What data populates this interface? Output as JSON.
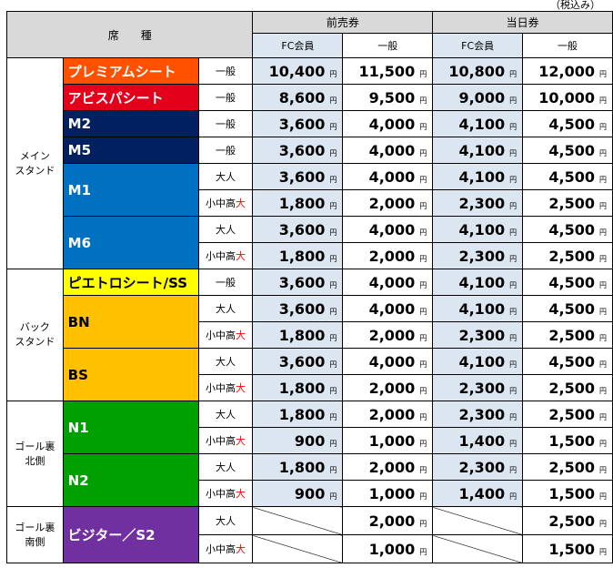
{
  "note": "（税込み）",
  "header": {
    "seat_type": "席　　種",
    "advance": "前売券",
    "same_day": "当日券",
    "fc_member": "FC会員",
    "general": "一般"
  },
  "yen_mark": "円",
  "sections": [
    {
      "area": "メイン\nスタンド",
      "seats": [
        {
          "name": "プレミアムシート",
          "bg": "#ff5000",
          "fg": "#ffffff",
          "rows": [
            {
              "sub": "一般",
              "subRed": "",
              "prices": [
                "10,400",
                "11,500",
                "10,800",
                "12,000"
              ]
            }
          ]
        },
        {
          "name": "アビスパシート",
          "bg": "#e2001a",
          "fg": "#ffffff",
          "rows": [
            {
              "sub": "一般",
              "subRed": "",
              "prices": [
                "8,600",
                "9,500",
                "9,000",
                "10,000"
              ]
            }
          ]
        },
        {
          "name": "M2",
          "bg": "#002060",
          "fg": "#ffffff",
          "rows": [
            {
              "sub": "一般",
              "subRed": "",
              "prices": [
                "3,600",
                "4,000",
                "4,100",
                "4,500"
              ]
            }
          ]
        },
        {
          "name": "M5",
          "bg": "#002060",
          "fg": "#ffffff",
          "rows": [
            {
              "sub": "一般",
              "subRed": "",
              "prices": [
                "3,600",
                "4,000",
                "4,100",
                "4,500"
              ]
            }
          ]
        },
        {
          "name": "M1",
          "bg": "#0070c0",
          "fg": "#ffffff",
          "rows": [
            {
              "sub": "大人",
              "subRed": "",
              "prices": [
                "3,600",
                "4,000",
                "4,100",
                "4,500"
              ]
            },
            {
              "sub": "小中高",
              "subRed": "大",
              "prices": [
                "1,800",
                "2,000",
                "2,300",
                "2,500"
              ]
            }
          ]
        },
        {
          "name": "M6",
          "bg": "#0070c0",
          "fg": "#ffffff",
          "rows": [
            {
              "sub": "大人",
              "subRed": "",
              "prices": [
                "3,600",
                "4,000",
                "4,100",
                "4,500"
              ]
            },
            {
              "sub": "小中高",
              "subRed": "大",
              "prices": [
                "1,800",
                "2,000",
                "2,300",
                "2,500"
              ]
            }
          ]
        }
      ]
    },
    {
      "area": "バック\nスタンド",
      "seats": [
        {
          "name": "ピエトロシート/SS",
          "bg": "#ffff00",
          "fg": "#000000",
          "rows": [
            {
              "sub": "一般",
              "subRed": "",
              "prices": [
                "3,600",
                "4,000",
                "4,100",
                "4,500"
              ]
            }
          ]
        },
        {
          "name": "BN",
          "bg": "#ffc000",
          "fg": "#000000",
          "rows": [
            {
              "sub": "大人",
              "subRed": "",
              "prices": [
                "3,600",
                "4,000",
                "4,100",
                "4,500"
              ]
            },
            {
              "sub": "小中高",
              "subRed": "大",
              "prices": [
                "1,800",
                "2,000",
                "2,300",
                "2,500"
              ]
            }
          ]
        },
        {
          "name": "BS",
          "bg": "#ffc000",
          "fg": "#000000",
          "rows": [
            {
              "sub": "大人",
              "subRed": "",
              "prices": [
                "3,600",
                "4,000",
                "4,100",
                "4,500"
              ]
            },
            {
              "sub": "小中高",
              "subRed": "大",
              "prices": [
                "1,800",
                "2,000",
                "2,300",
                "2,500"
              ]
            }
          ]
        }
      ]
    },
    {
      "area": "ゴール裏\n北側",
      "seats": [
        {
          "name": "N1",
          "bg": "#00a000",
          "fg": "#ffffff",
          "rows": [
            {
              "sub": "大人",
              "subRed": "",
              "prices": [
                "1,800",
                "2,000",
                "2,300",
                "2,500"
              ]
            },
            {
              "sub": "小中高",
              "subRed": "大",
              "prices": [
                "900",
                "1,000",
                "1,400",
                "1,500"
              ]
            }
          ]
        },
        {
          "name": "N2",
          "bg": "#00a000",
          "fg": "#ffffff",
          "rows": [
            {
              "sub": "大人",
              "subRed": "",
              "prices": [
                "1,800",
                "2,000",
                "2,300",
                "2,500"
              ]
            },
            {
              "sub": "小中高",
              "subRed": "大",
              "prices": [
                "900",
                "1,000",
                "1,400",
                "1,500"
              ]
            }
          ]
        }
      ]
    },
    {
      "area": "ゴール裏\n南側",
      "seats": [
        {
          "name": "ビジター／S2",
          "bg": "#7030a0",
          "fg": "#ffffff",
          "rows": [
            {
              "sub": "大人",
              "subRed": "",
              "prices": [
                null,
                "2,000",
                null,
                "2,500"
              ]
            },
            {
              "sub": "小中高",
              "subRed": "大",
              "prices": [
                null,
                "1,000",
                null,
                "1,500"
              ]
            }
          ]
        }
      ]
    }
  ]
}
